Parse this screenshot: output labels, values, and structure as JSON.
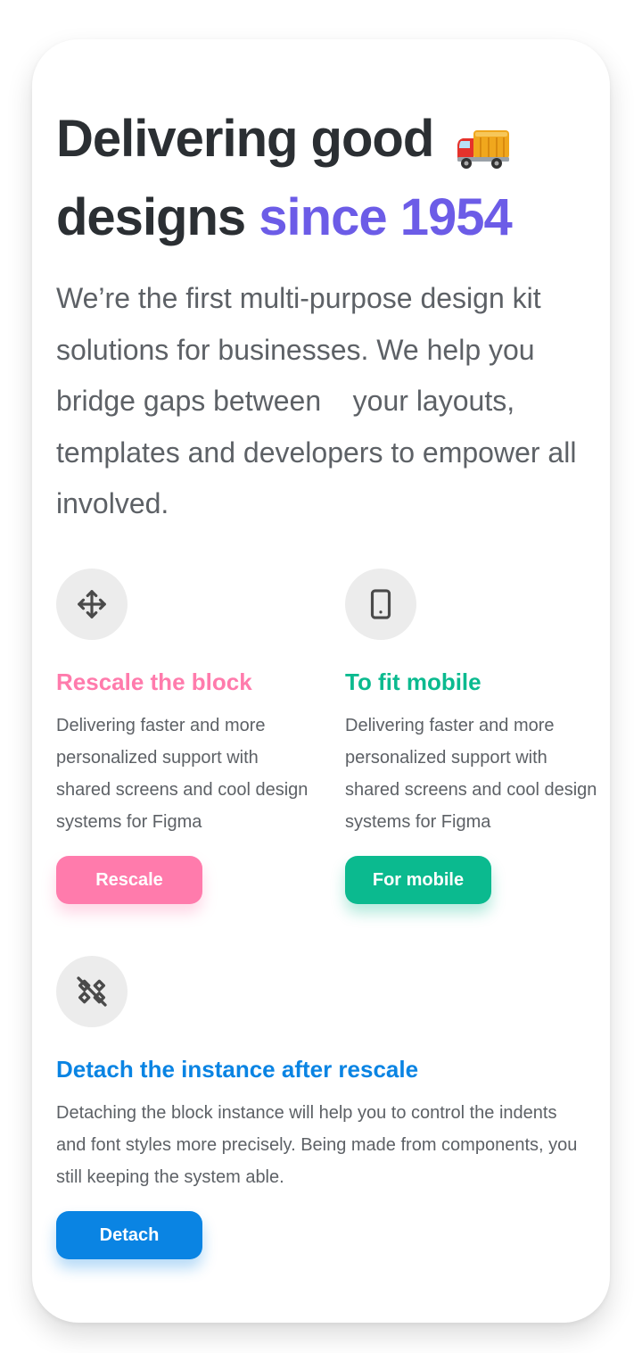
{
  "hero": {
    "title_line1": "Delivering good",
    "title_line2": "designs ",
    "title_accent": "since 1954",
    "truck_icon": "delivery-truck-emoji",
    "description": "We’re the first multi-purpose design kit solutions for businesses. We help you bridge gaps between    your layouts, templates and developers to empower all involved."
  },
  "features": [
    {
      "icon": "move-arrows-icon",
      "title": "Rescale the block",
      "description": "Delivering faster and more personalized support with shared screens and cool design systems for Figma",
      "button_label": "Rescale",
      "color": "#ff7bac"
    },
    {
      "icon": "smartphone-icon",
      "title": "To fit mobile",
      "description": "Delivering faster and more personalized support with shared screens and cool design systems for Figma",
      "button_label": "For mobile",
      "color": "#0bba8f"
    },
    {
      "icon": "detach-component-icon",
      "title": "Detach the instance after rescale",
      "description": "Detaching the block instance will help you to control the indents and font styles more precisely. Being made from components, you still keeping the system able.",
      "button_label": "Detach",
      "color": "#0a84e3"
    }
  ],
  "colors": {
    "accent": "#6c5ce7",
    "heading": "#2b2f33",
    "body_text": "#5d6166"
  }
}
